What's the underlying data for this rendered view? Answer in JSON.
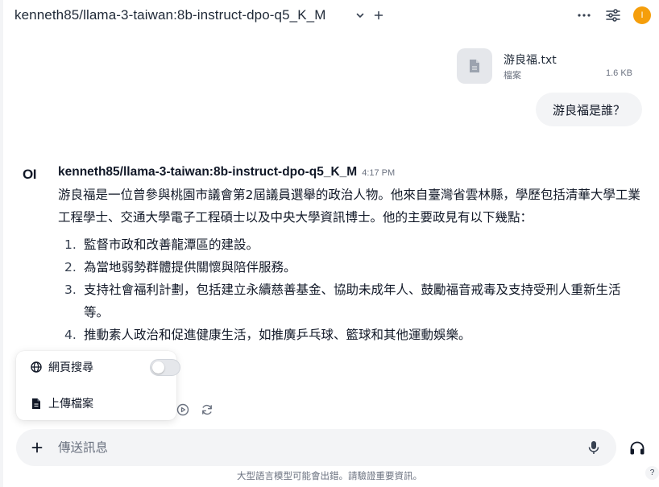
{
  "header": {
    "model_name": "kenneth85/llama-3-taiwan:8b-instruct-dpo-q5_K_M",
    "avatar_initial": "I",
    "avatar_color": "#f59e0b"
  },
  "file": {
    "name": "游良福.txt",
    "type": "檔案",
    "size": "1.6 KB"
  },
  "user_message": "游良福是誰？",
  "assistant": {
    "logo": "OI",
    "name": "kenneth85/llama-3-taiwan:8b-instruct-dpo-q5_K_M",
    "time": "4:17 PM",
    "paragraph": "游良福是一位曾參與桃園市議會第2屆議員選舉的政治人物。他來自臺灣省雲林縣，學歷包括清華大學工業工程學士、交通大學電子工程碩士以及中央大學資訊博士。他的主要政見有以下幾點：",
    "points": [
      {
        "num": "1.",
        "text": "監督市政和改善龍潭區的建設。"
      },
      {
        "num": "2.",
        "text": "為當地弱勢群體提供關懷與陪伴服務。"
      },
      {
        "num": "3.",
        "text": "支持社會福利計劃，包括建立永續慈善基金、協助未成年人、鼓勵福音戒毒及支持受刑人重新生活等。"
      },
      {
        "num": "4.",
        "text": "推動素人政治和促進健康生活，如推廣乒乓球、籃球和其他運動娛樂。"
      }
    ]
  },
  "popup": {
    "web_search_label": "網頁搜尋",
    "web_search_enabled": false,
    "upload_label": "上傳檔案"
  },
  "input": {
    "placeholder": "傳送訊息"
  },
  "footer": {
    "disclaimer": "大型語言模型可能會出錯。請驗證重要資訊。",
    "help": "?"
  }
}
